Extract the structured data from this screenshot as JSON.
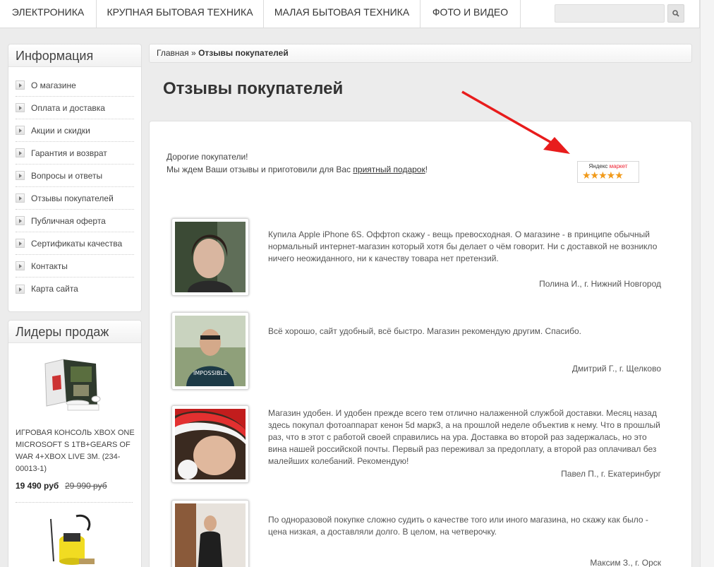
{
  "nav": {
    "items": [
      "Электроника",
      "Крупная бытовая техника",
      "Малая бытовая техника",
      "Фото и видео"
    ],
    "search_placeholder": "",
    "search_icon": "search-icon"
  },
  "sidebar": {
    "info_title": "Информация",
    "info_items": [
      "О магазине",
      "Оплата и доставка",
      "Акции и скидки",
      "Гарантия и возврат",
      "Вопросы и ответы",
      "Отзывы покупателей",
      "Публичная оферта",
      "Сертификаты качества",
      "Контакты",
      "Карта сайта"
    ],
    "leaders_title": "Лидеры продаж",
    "leaders": [
      {
        "name": "ИГРОВАЯ КОНСОЛЬ XBOX ONE MICROSOFT S 1TB+GEARS OF WAR 4+XBOX LIVE 3М. (234-00013-1)",
        "price": "19 490 руб",
        "old_price": "29 990 руб"
      }
    ]
  },
  "breadcrumb": {
    "home": "Главная",
    "separator": "»",
    "current": "Отзывы покупателей"
  },
  "page_title": "Отзывы покупателей",
  "intro": {
    "line1": "Дорогие покупатели!",
    "line2_prefix": "Мы ждем Ваши отзывы и приготовили для Вас ",
    "gift_link": "приятный подарок",
    "line2_suffix": "!"
  },
  "yandex_badge": {
    "brand": "Яндекс",
    "suffix": "маркет",
    "stars": "★★★★★",
    "rating": 5
  },
  "reviews": [
    {
      "text": "Купила Apple iPhone 6S. Оффтоп скажу - вещь превосходная. О магазине - в принципе обычный нормальный интернет-магазин который хотя бы делает о чём говорит. Ни с доставкой не возникло ничего неожиданного, ни к качеству товара нет претензий.",
      "author": "Полина И., г. Нижний Новгород"
    },
    {
      "text": "Всё хорошо, сайт удобный, всё быстро. Магазин рекомендую другим. Спасибо.",
      "author": "Дмитрий Г., г. Щелково"
    },
    {
      "text": "Магазин удобен. И удобен прежде всего тем отлично налаженной службой доставки. Месяц назад здесь покупал фотоаппарат кенон 5d марк3, а на прошлой неделе объектив к нему. Что в прошлый раз, что в этот с работой своей справились на ура. Доставка во второй раз задержалась, но это вина нашей российской почты. Первый раз переживал за предоплату, а второй раз оплачивал без малейших колебаний. Рекомендую!",
      "author": "Павел П., г. Екатеринбург"
    },
    {
      "text": "По одноразовой покупке сложно судить о качестве того или иного магазина, но скажу как было - цена низкая, а доставляли долго. В целом, на четверочку.",
      "author": "Максим З., г. Орск"
    }
  ],
  "colors": {
    "accent_arrow": "#e81c1c",
    "stars": "#f19a1a",
    "yandex_red": "#ee2222"
  }
}
